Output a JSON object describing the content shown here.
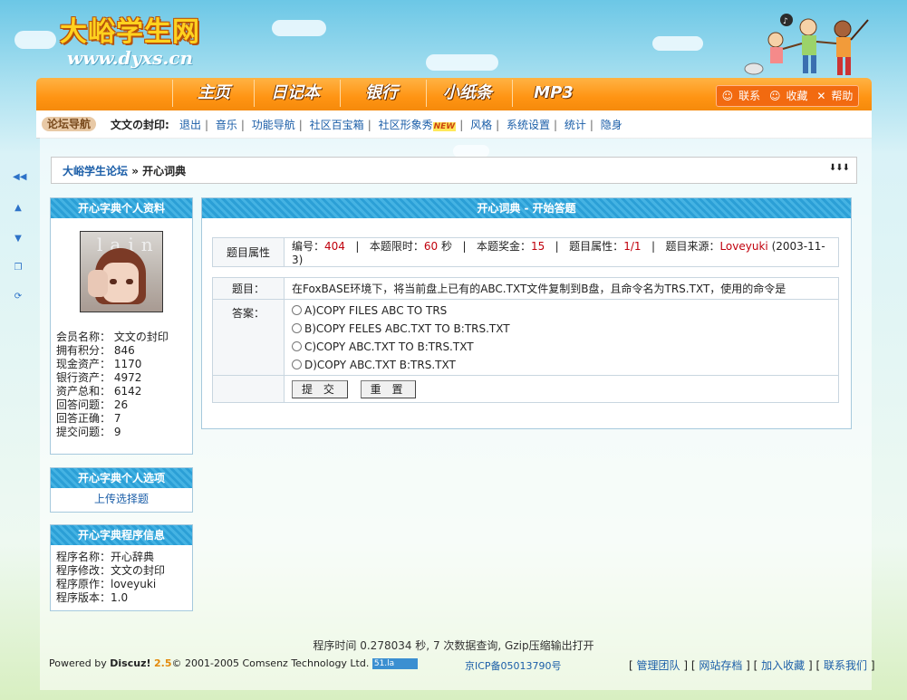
{
  "header": {
    "logo_text": "大峪学生网",
    "logo_url": "www.dyxs.cn",
    "nav": [
      "主页",
      "日记本",
      "银行",
      "小纸条",
      "MP3"
    ],
    "right_links": [
      "联系",
      "收藏",
      "帮助"
    ]
  },
  "subnav": {
    "tag": "论坛导航",
    "user": "文文の封印:",
    "links": [
      "退出",
      "音乐",
      "功能导航",
      "社区百宝箱",
      "社区形象秀",
      "风格",
      "系统设置",
      "统计",
      "隐身"
    ],
    "new_badge": "NEW"
  },
  "breadcrumb": {
    "home": "大峪学生论坛",
    "current": "» 开心词典",
    "arrows": "⬇⬇⬇"
  },
  "profile": {
    "title": "开心字典个人资料",
    "avatar_text": "lain",
    "rows": [
      "会员名称： 文文の封印",
      "拥有积分： 846",
      "现金资产： 1170",
      "银行资产： 4972",
      "资产总和： 6142",
      "回答问题： 26",
      "回答正确： 7",
      "提交问题： 9"
    ]
  },
  "options": {
    "title": "开心字典个人选项",
    "upload": "上传选择题"
  },
  "program": {
    "title": "开心字典程序信息",
    "rows": [
      "程序名称：开心辞典",
      "程序修改：文文の封印",
      "程序原作：loveyuki",
      "程序版本：1.0"
    ]
  },
  "quiz": {
    "title": "开心词典 - 开始答题",
    "attr_label": "题目属性",
    "num_label": "编号：",
    "num": "404",
    "time_label": "本题限时：",
    "time": "60",
    "time_unit": "秒",
    "prize_label": "本题奖金：",
    "prize": "15",
    "attr2_label": "题目属性：",
    "attr2": "1/1",
    "source_label": "题目来源：",
    "source": "Loveyuki",
    "source_date": "(2003-11-3)",
    "question_label": "题目：",
    "question": "在FoxBASE环境下，将当前盘上已有的ABC.TXT文件复制到B盘，且命令名为TRS.TXT，使用的命令是",
    "answer_label": "答案：",
    "answers": [
      "A)COPY FILES ABC TO TRS",
      "B)COPY FELES ABC.TXT TO B:TRS.TXT",
      "C)COPY ABC.TXT TO B:TRS.TXT",
      "D)COPY ABC.TXT B:TRS.TXT"
    ],
    "submit": "提 交",
    "reset": "重 置"
  },
  "footer": {
    "stats": "程序时间 0.278034 秒, 7 次数据查询, Gzip压缩输出打开",
    "powered": "Powered by ",
    "discuz": "Discuz!",
    "version": "2.5",
    "copyright": "© 2001-2005 Comsenz Technology Ltd.",
    "badge": "51.la",
    "icp": "京ICP备05013790号",
    "links": [
      "管理团队",
      "网站存档",
      "加入收藏",
      "联系我们"
    ]
  }
}
